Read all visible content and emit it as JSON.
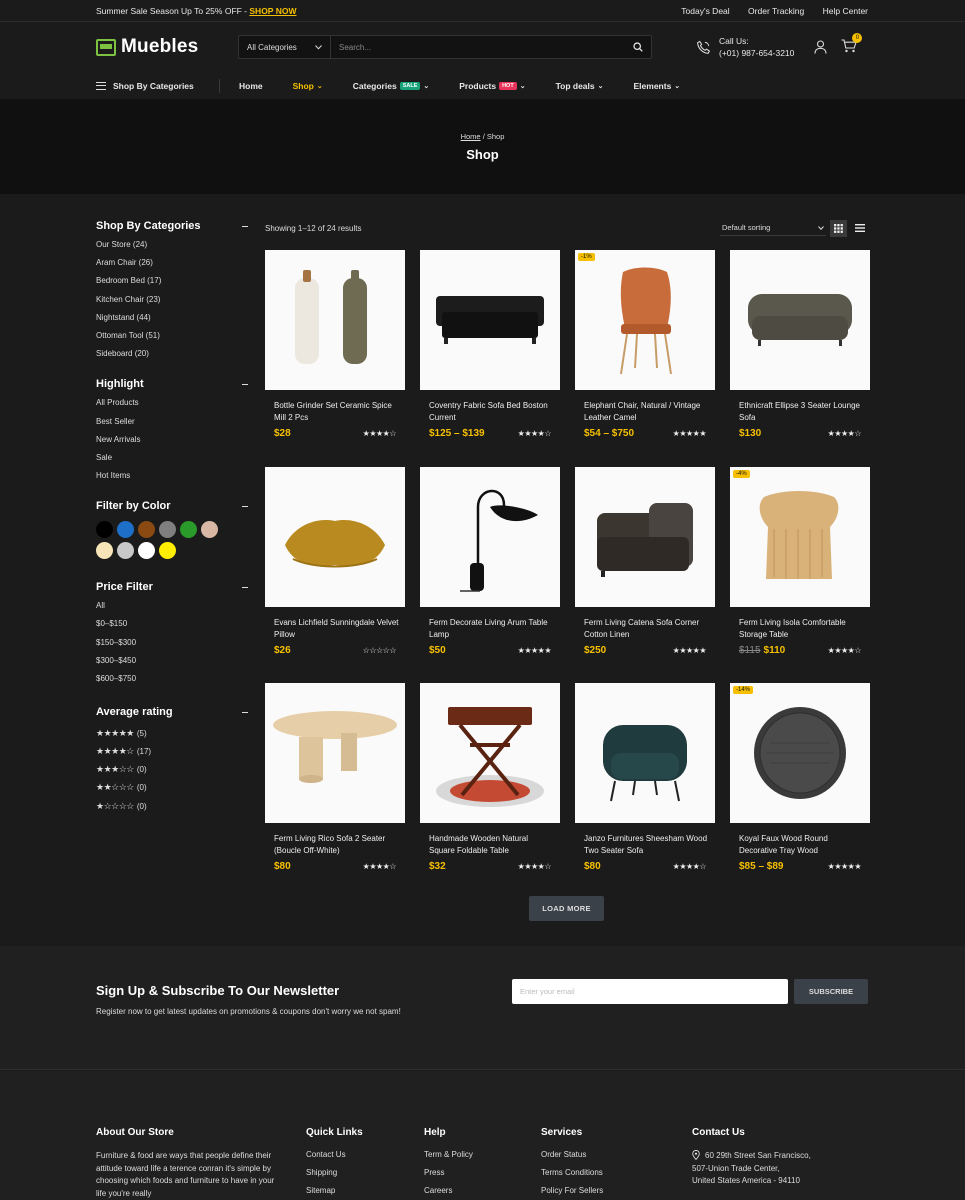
{
  "topbar": {
    "sale_text": "Summer Sale Season Up To 25% OFF - ",
    "sale_link": "SHOP NOW",
    "links": [
      "Today's Deal",
      "Order Tracking",
      "Help Center"
    ]
  },
  "header": {
    "logo": "Muebles",
    "category_select": "All Categories",
    "search_placeholder": "Search...",
    "call_label": "Call Us:",
    "phone": "(+01) 987-654-3210",
    "cart_count": "0"
  },
  "nav": {
    "shop_by": "Shop By Categories",
    "items": [
      {
        "label": "Home",
        "badge": ""
      },
      {
        "label": "Shop",
        "badge": ""
      },
      {
        "label": "Categories",
        "badge": "SALE"
      },
      {
        "label": "Products",
        "badge": "HOT"
      },
      {
        "label": "Top deals",
        "badge": ""
      },
      {
        "label": "Elements",
        "badge": ""
      }
    ]
  },
  "banner": {
    "crumb_home": "Home",
    "crumb_sep": " / ",
    "crumb_current": "Shop",
    "title": "Shop"
  },
  "sidebar": {
    "categories_title": "Shop By Categories",
    "categories": [
      "Our Store (24)",
      "Aram Chair (26)",
      "Bedroom Bed (17)",
      "Kitchen Chair (23)",
      "Nightstand (44)",
      "Ottoman Tool (51)",
      "Sideboard (20)"
    ],
    "highlight_title": "Highlight",
    "highlights": [
      "All Products",
      "Best Seller",
      "New Arrivals",
      "Sale",
      "Hot Items"
    ],
    "color_title": "Filter by Color",
    "colors": [
      "#000000",
      "#1e6fc8",
      "#8a4a12",
      "#7f7f7f",
      "#2a9a2a",
      "#d8b8a4",
      "#f7e4b8",
      "#c8c8c8",
      "#ffffff",
      "#ffee00"
    ],
    "price_title": "Price Filter",
    "prices": [
      "All",
      "$0–$150",
      "$150–$300",
      "$300–$450",
      "$600–$750"
    ],
    "rating_title": "Average rating",
    "ratings": [
      {
        "stars": "★★★★★",
        "count": "(5)"
      },
      {
        "stars": "★★★★☆",
        "count": "(17)"
      },
      {
        "stars": "★★★☆☆",
        "count": "(0)"
      },
      {
        "stars": "★★☆☆☆",
        "count": "(0)"
      },
      {
        "stars": "★☆☆☆☆",
        "count": "(0)"
      }
    ]
  },
  "toolbar": {
    "result_count": "Showing 1–12 of 24 results",
    "sorting": "Default sorting"
  },
  "products": [
    {
      "title": "Bottle Grinder Set Ceramic Spice Mill 2 Pcs",
      "price": "$28",
      "old": "",
      "stars": "★★★★☆",
      "sale": ""
    },
    {
      "title": "Coventry Fabric Sofa Bed Boston Current",
      "price": "$125 – $139",
      "old": "",
      "stars": "★★★★☆",
      "sale": ""
    },
    {
      "title": "Elephant Chair, Natural / Vintage Leather Camel",
      "price": "$54 – $750",
      "old": "",
      "stars": "★★★★★",
      "sale": "-1%"
    },
    {
      "title": "Ethnicraft Ellipse 3 Seater Lounge Sofa",
      "price": "$130",
      "old": "",
      "stars": "★★★★☆",
      "sale": ""
    },
    {
      "title": "Evans Lichfield Sunningdale Velvet Pillow",
      "price": "$26",
      "old": "",
      "stars": "☆☆☆☆☆",
      "sale": ""
    },
    {
      "title": "Ferm Decorate Living Arum Table Lamp",
      "price": "$50",
      "old": "",
      "stars": "★★★★★",
      "sale": ""
    },
    {
      "title": "Ferm Living Catena Sofa Corner Cotton Linen",
      "price": "$250",
      "old": "",
      "stars": "★★★★★",
      "sale": ""
    },
    {
      "title": "Ferm Living Isola Comfortable Storage Table",
      "price": "$110",
      "old": "$115",
      "stars": "★★★★☆",
      "sale": "-4%"
    },
    {
      "title": "Ferm Living Rico Sofa 2 Seater (Boucle Off-White)",
      "price": "$80",
      "old": "",
      "stars": "★★★★☆",
      "sale": ""
    },
    {
      "title": "Handmade Wooden Natural Square Foldable Table",
      "price": "$32",
      "old": "",
      "stars": "★★★★☆",
      "sale": ""
    },
    {
      "title": "Janzo Furnitures Sheesham Wood Two Seater Sofa",
      "price": "$80",
      "old": "",
      "stars": "★★★★☆",
      "sale": ""
    },
    {
      "title": "Koyal Faux Wood Round Decorative Tray Wood",
      "price": "$85 – $89",
      "old": "",
      "stars": "★★★★★",
      "sale": "-14%"
    }
  ],
  "load_more": "LOAD MORE",
  "newsletter": {
    "title": "Sign Up & Subscribe To Our Newsletter",
    "subtitle": "Register now to get latest updates on promotions & coupons don't worry we not spam!",
    "placeholder": "Enter your email",
    "button": "SUBSCRIBE"
  },
  "footer": {
    "about_title": "About Our Store",
    "about_text": "Furniture & food are ways that people define their attitude toward life a terence conran it's simple by choosing which foods and furniture to have in your life you're really",
    "quick_title": "Quick Links",
    "quick": [
      "Contact Us",
      "Shipping",
      "Sitemap"
    ],
    "help_title": "Help",
    "help": [
      "Term & Policy",
      "Press",
      "Careers"
    ],
    "services_title": "Services",
    "services": [
      "Order Status",
      "Terms Conditions",
      "Policy For Sellers"
    ],
    "contact_title": "Contact Us",
    "address": [
      "60 29th Street San Francisco,",
      "507-Union Trade Center,",
      "United States America - 94110"
    ]
  },
  "colors": {
    "accent": "#f6c000",
    "brand": "#7ec242",
    "sale_badge": "#1aa37a",
    "hot_badge": "#e8335a"
  }
}
